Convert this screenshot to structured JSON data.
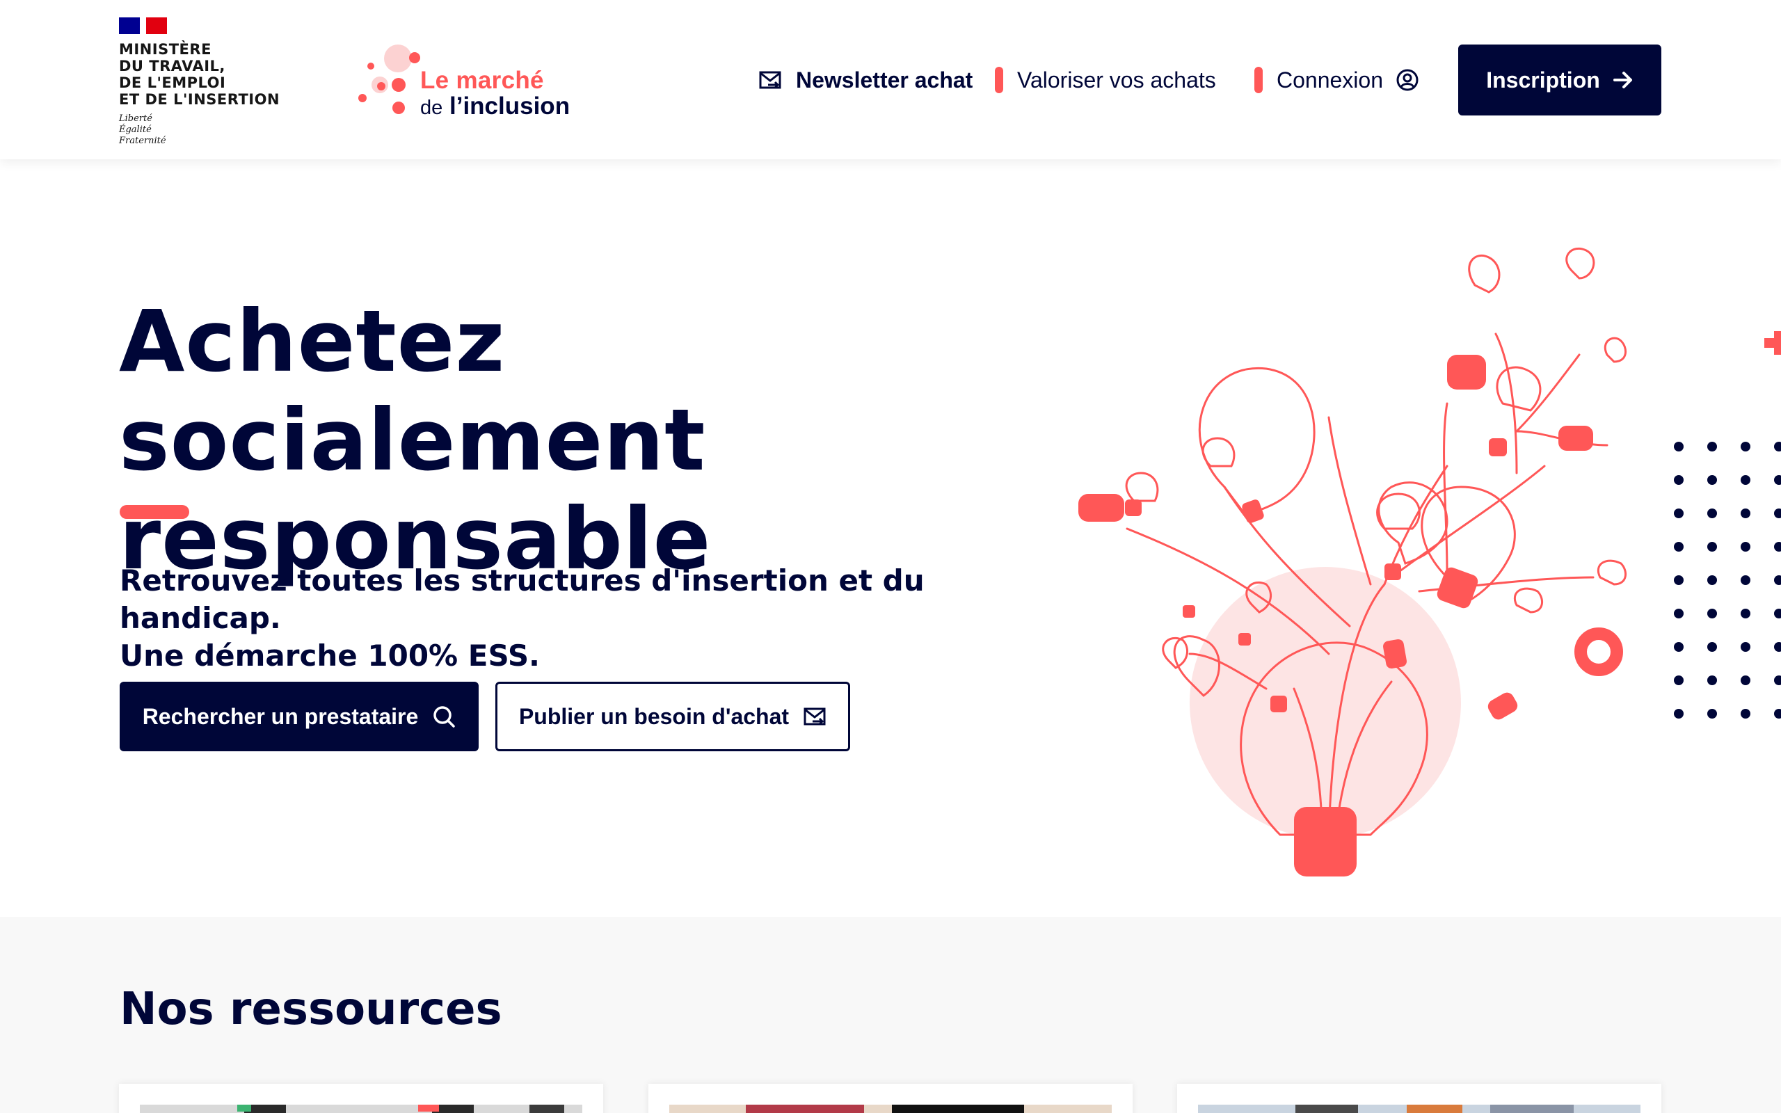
{
  "header": {
    "ministry_name": "MINISTÈRE\nDU TRAVAIL,\nDE L'EMPLOI\nET DE L'INSERTION",
    "ministry_motto": "Liberté\nÉgalité\nFraternité",
    "logo": {
      "top": "Le marché",
      "bottom_small": "de",
      "bottom_bold": "l’inclusion"
    },
    "nav": {
      "newsletter": "Newsletter achat",
      "valoriser": "Valoriser vos achats",
      "connexion": "Connexion"
    },
    "inscription_label": "Inscription"
  },
  "hero": {
    "title_line1": "Achetez socialement",
    "title_line2": "responsable",
    "subtitle_line1": "Retrouvez toutes les structures d'insertion et du handicap.",
    "subtitle_line2": "Une démarche 100% ESS.",
    "primary_button": "Rechercher un prestataire",
    "secondary_button": "Publier un besoin d'achat"
  },
  "resources": {
    "title": "Nos ressources"
  },
  "colors": {
    "navy": "#000638",
    "coral": "#ff5757",
    "light_pink": "#fde4e4",
    "section_bg": "#f8f8f8"
  },
  "icons": [
    "mail-icon",
    "user-circle-icon",
    "arrow-right-icon",
    "search-icon",
    "lightbulb-illustration"
  ]
}
